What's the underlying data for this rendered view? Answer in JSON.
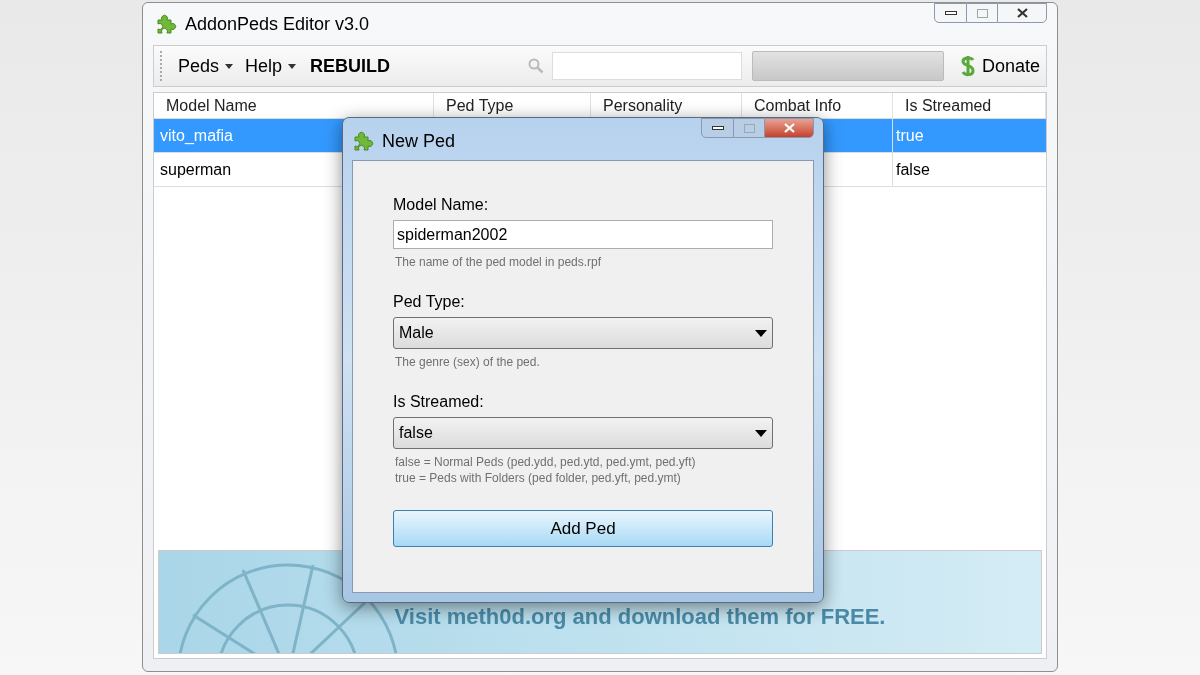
{
  "window": {
    "title": "AddonPeds Editor v3.0"
  },
  "toolbar": {
    "menus": [
      {
        "label": "Peds"
      },
      {
        "label": "Help"
      }
    ],
    "rebuild": "REBUILD",
    "progress": {
      "level": 0
    },
    "donate": "Donate"
  },
  "table": {
    "columns": [
      "Model Name",
      "Ped Type",
      "Personality",
      "Combat Info",
      "Is Streamed"
    ],
    "rows": [
      {
        "model_name": "vito_mafia",
        "is_streamed": "true",
        "selected": true
      },
      {
        "model_name": "superman",
        "is_streamed": "false",
        "selected": false
      }
    ]
  },
  "banner": {
    "text": "Visit meth0d.org and download them for FREE."
  },
  "dialog": {
    "title": "New Ped",
    "fields": [
      {
        "kind": "text",
        "label": "Model Name:",
        "value": "spiderman2002",
        "hint_lines": [
          "The name of the ped model in peds.rpf"
        ]
      },
      {
        "kind": "select",
        "label": "Ped Type:",
        "value": "Male",
        "hint_lines": [
          "The genre (sex) of the ped."
        ]
      },
      {
        "kind": "select",
        "label": "Is Streamed:",
        "value": "false",
        "hint_lines": [
          "false = Normal Peds (ped.ydd, ped.ytd, ped.ymt, ped.yft)",
          "true = Peds with Folders (ped folder, ped.yft, ped.ymt)"
        ]
      }
    ],
    "button": "Add Ped"
  }
}
